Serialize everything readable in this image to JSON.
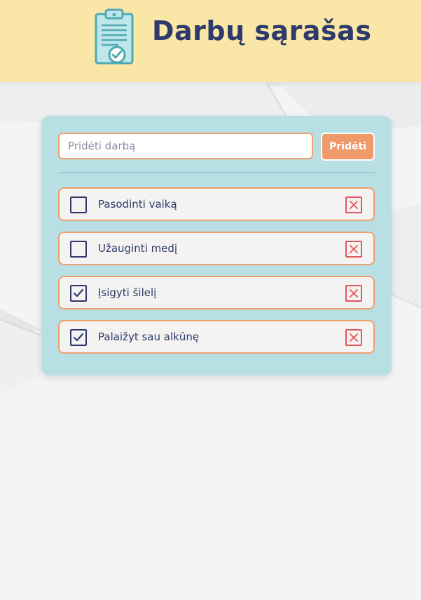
{
  "app": {
    "title": "Darbų sąrašas"
  },
  "form": {
    "placeholder": "Pridėti darbą",
    "value": "",
    "add_label": "Pridėti"
  },
  "todos": [
    {
      "text": "Pasodinti vaiką",
      "done": false
    },
    {
      "text": "Užauginti medį",
      "done": false
    },
    {
      "text": "Įsigyti šilelį",
      "done": true
    },
    {
      "text": "Palaižyt sau alkūnę",
      "done": true
    }
  ],
  "colors": {
    "header_bg": "#fae6a6",
    "title": "#2e3a6b",
    "card_bg": "#b8dfe3",
    "accent": "#f09a6a",
    "item_border": "#eea06e",
    "delete": "#e0575f"
  },
  "icons": {
    "logo": "clipboard-check-icon",
    "checkbox_mark": "check-icon",
    "delete": "close-icon"
  }
}
